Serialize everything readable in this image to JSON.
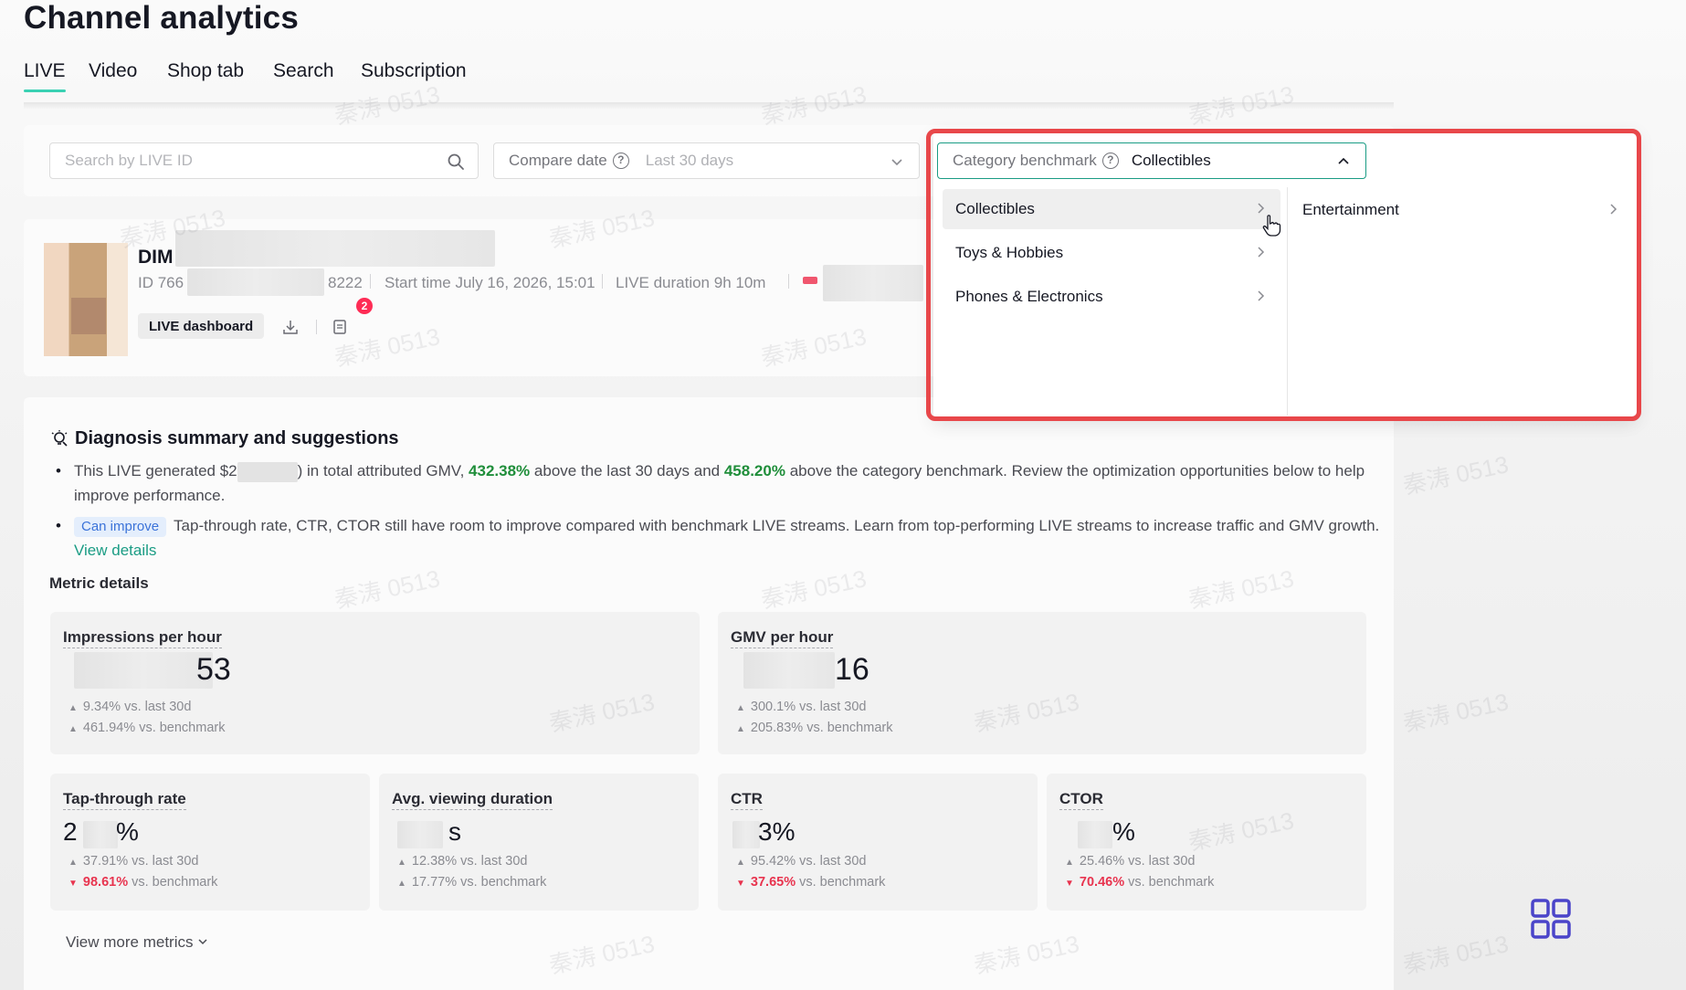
{
  "page_title": "Channel analytics",
  "tabs": [
    {
      "label": "LIVE",
      "active": true
    },
    {
      "label": "Video",
      "active": false
    },
    {
      "label": "Shop tab",
      "active": false
    },
    {
      "label": "Search",
      "active": false
    },
    {
      "label": "Subscription",
      "active": false
    }
  ],
  "filters": {
    "search_placeholder": "Search by LIVE ID",
    "compare_label": "Compare date",
    "compare_value": "Last 30 days",
    "benchmark_label": "Category benchmark",
    "benchmark_value": "Collectibles"
  },
  "dropdown": {
    "level1": [
      {
        "label": "Collectibles",
        "hover": true
      },
      {
        "label": "Toys & Hobbies",
        "hover": false
      },
      {
        "label": "Phones & Electronics",
        "hover": false
      }
    ],
    "level2": [
      {
        "label": "Entertainment"
      }
    ]
  },
  "live": {
    "name_prefix": "DIM",
    "id_prefix": "ID 766",
    "id_suffix": "8222",
    "start_time": "Start time July 16, 2026, 15:01",
    "duration": "LIVE duration 9h 10m",
    "dashboard_button": "LIVE dashboard",
    "badge_count": "2"
  },
  "diagnosis": {
    "title": "Diagnosis summary and suggestions",
    "bullet1": {
      "part1": "This LIVE generated $2",
      "part2": ") in total attributed GMV,",
      "pct1": "432.38%",
      "part3": "above the last 30 days and",
      "pct2": "458.20%",
      "part4": "above the category benchmark. Review the optimization opportunities below to help improve performance."
    },
    "bullet2": {
      "tag": "Can improve",
      "text": "Tap-through rate, CTR, CTOR still have room to improve compared with benchmark LIVE streams. Learn from top-performing LIVE streams to increase traffic and GMV growth.",
      "link": "View details"
    },
    "metric_details_label": "Metric details"
  },
  "metrics": {
    "impressions": {
      "title": "Impressions per hour",
      "value_suffix": "53",
      "d1": "9.34%",
      "d1_label": "vs. last 30d",
      "d2": "461.94%",
      "d2_label": "vs. benchmark"
    },
    "gmv": {
      "title": "GMV per hour",
      "value_suffix": "16",
      "d1": "300.1%",
      "d1_label": "vs. last 30d",
      "d2": "205.83%",
      "d2_label": "vs. benchmark"
    },
    "tap": {
      "title": "Tap-through rate",
      "value_prefix": "2",
      "value_suffix": "%",
      "d1": "37.91%",
      "d1_label": "vs. last 30d",
      "d2": "98.61%",
      "d2_label": "vs. benchmark"
    },
    "avg": {
      "title": "Avg. viewing duration",
      "value_suffix": "s",
      "d1": "12.38%",
      "d1_label": "vs. last 30d",
      "d2": "17.77%",
      "d2_label": "vs. benchmark"
    },
    "ctr": {
      "title": "CTR",
      "value_suffix": "3%",
      "d1": "95.42%",
      "d1_label": "vs. last 30d",
      "d2": "37.65%",
      "d2_label": "vs. benchmark"
    },
    "ctor": {
      "title": "CTOR",
      "value_suffix": "%",
      "d1": "25.46%",
      "d1_label": "vs. last 30d",
      "d2": "70.46%",
      "d2_label": "vs. benchmark"
    }
  },
  "view_more": "View more metrics",
  "watermark_text": "秦涛 0513",
  "colors": {
    "accent": "#1a9c84",
    "highlight": "#e8474a",
    "positive": "#1f8e3a",
    "negative": "#e8344f",
    "tag_bg": "#e4eefc"
  }
}
